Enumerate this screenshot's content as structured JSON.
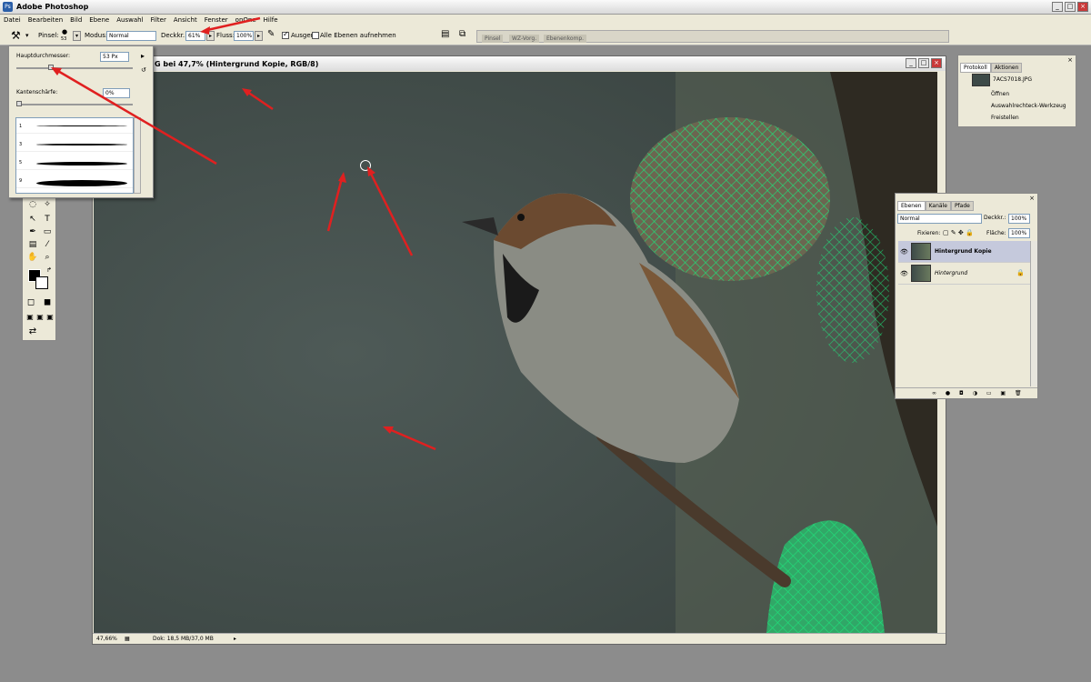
{
  "app": {
    "title": "Adobe Photoshop",
    "icon": "photoshop-icon"
  },
  "menu": [
    "Datei",
    "Bearbeiten",
    "Bild",
    "Ebene",
    "Auswahl",
    "Filter",
    "Ansicht",
    "Fenster",
    "onOne",
    "Hilfe"
  ],
  "options": {
    "pinsel_label": "Pinsel:",
    "brush_size": "53",
    "modus_label": "Modus:",
    "modus_value": "Normal",
    "deckkr_label": "Deckkr.:",
    "deckkr_value": "61%",
    "fluss_label": "Fluss:",
    "fluss_value": "100%",
    "ausger_label": "Ausger.",
    "ausger_checked": true,
    "alle_ebenen_label": "Alle Ebenen aufnehmen",
    "alle_ebenen_checked": false
  },
  "well_tabs": [
    "Pinsel",
    "WZ-Vorg.",
    "Ebenenkomp."
  ],
  "brush_panel": {
    "diameter_label": "Hauptdurchmesser:",
    "diameter_value": "53 Px",
    "diameter_fraction": 0.3,
    "hardness_label": "Kantenschärfe:",
    "hardness_value": "0%",
    "hardness_fraction": 0.0,
    "presets": [
      {
        "n": "1"
      },
      {
        "n": "3"
      },
      {
        "n": "5"
      },
      {
        "n": "9"
      }
    ]
  },
  "document": {
    "title": "G bei 47,7% (Hintergrund Kopie, RGB/8)",
    "zoom": "47,66%",
    "doc_info": "Dok: 18,5 MB/37,0 MB"
  },
  "history_panel": {
    "tabs": [
      "Protokoll",
      "Aktionen"
    ],
    "snapshot": "7ACS7018.JPG",
    "items": [
      "Öffnen",
      "Auswahlrechteck-Werkzeug",
      "Freistellen"
    ]
  },
  "layers_panel": {
    "tabs": [
      "Ebenen",
      "Kanäle",
      "Pfade"
    ],
    "blend_mode": "Normal",
    "deckkr_label": "Deckkr.:",
    "deckkr_value": "100%",
    "fixieren_label": "Fixieren:",
    "flaeche_label": "Fläche:",
    "flaeche_value": "100%",
    "layers": [
      {
        "name": "Hintergrund Kopie",
        "selected": true
      },
      {
        "name": "Hintergrund",
        "selected": false
      }
    ]
  },
  "colors": {
    "accent": "#2a5ea8",
    "arrow": "#e02020",
    "net": "#1fe07a"
  }
}
